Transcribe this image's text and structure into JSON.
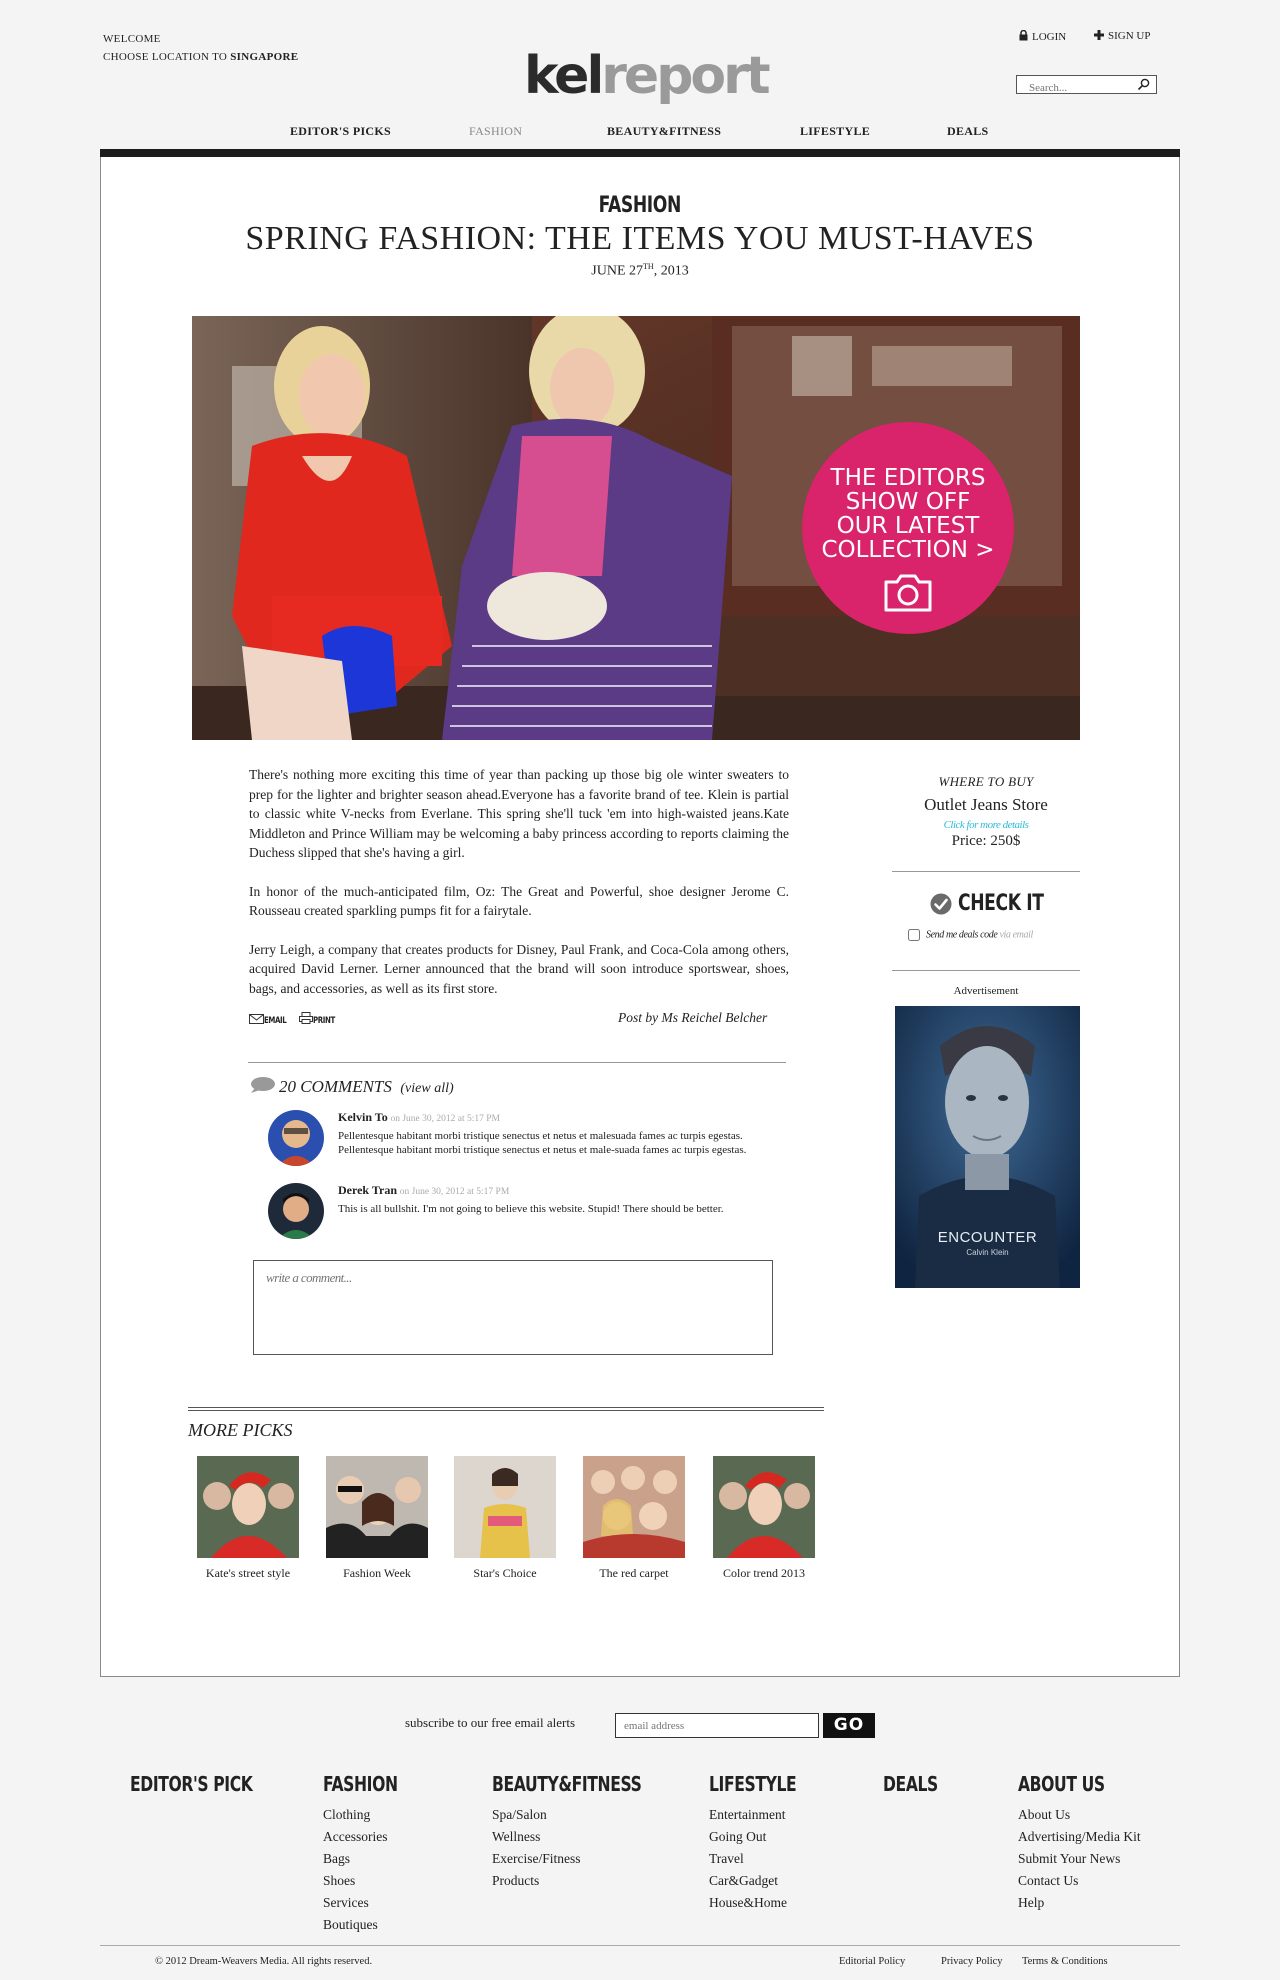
{
  "header": {
    "welcome": "WELCOME",
    "location_prefix": "CHOOSE LOCATION TO",
    "location": "SINGAPORE",
    "logo_part1": "kel",
    "logo_part2": "report",
    "login": "LOGIN",
    "signup": "SIGN UP",
    "search_placeholder": "Search..."
  },
  "nav": {
    "items": [
      "EDITOR'S PICKS",
      "FASHION",
      "BEAUTY&FITNESS",
      "LIFESTYLE",
      "DEALS"
    ],
    "active": "FASHION"
  },
  "article": {
    "section": "FASHION",
    "title": "SPRING FASHION: THE ITEMS YOU MUST-HAVES",
    "date_prefix": "JUNE 27",
    "date_sup": "TH",
    "date_suffix": ", 2013",
    "promo_lines": [
      "THE EDITORS",
      "SHOW OFF",
      "OUR LATEST",
      "COLLECTION >"
    ],
    "paragraphs": [
      "There's nothing more exciting this time of year than packing up those big ole winter sweaters to prep for the lighter and brighter season ahead.Everyone has a favorite brand of tee. Klein is partial to classic white V-necks from Everlane. This spring she'll tuck 'em into high-waisted jeans.Kate Middleton and Prince William may be welcoming a baby princess according to reports claiming the Duchess slipped that she's having a girl.",
      "In honor of the much-anticipated film, Oz: The Great and Powerful, shoe designer Jerome C. Rousseau created sparkling pumps fit for a fairytale.",
      "Jerry Leigh, a company that creates products for Disney, Paul Frank, and Coca-Cola among others, acquired David Lerner. Lerner announced that the brand will soon introduce sportswear, shoes, bags, and accessories, as well as its first store."
    ],
    "email_label": "EMAIL",
    "print_label": "PRINT",
    "byline": "Post by Ms Reichel Belcher"
  },
  "comments": {
    "count_label": "20 COMMENTS",
    "view_all": "(view all)",
    "items": [
      {
        "name": "Kelvin To",
        "time": "on June 30, 2012 at 5:17 PM",
        "text": "Pellentesque habitant morbi tristique senectus et netus et malesuada fames ac turpis egestas. Pellentesque habitant morbi tristique senectus et netus et male-suada fames ac turpis egestas."
      },
      {
        "name": "Derek Tran",
        "time": "on June 30, 2012 at 5:17 PM",
        "text": "This is all bullshit. I'm not going to believe this website. Stupid! There should be better."
      }
    ],
    "write_placeholder": "write a comment..."
  },
  "more_picks": {
    "title": "MORE PICKS",
    "items": [
      "Kate's street style",
      "Fashion Week",
      "Star's Choice",
      "The red carpet",
      "Color trend 2013"
    ]
  },
  "sidebar": {
    "where_to_buy": "WHERE TO BUY",
    "store": "Outlet Jeans Store",
    "click": "Click for more details",
    "price": "Price: 250$",
    "checkit": "CHECK IT",
    "deals_code": "Send me deals code",
    "deals_via": "via email",
    "ad_label": "Advertisement",
    "ad_brand": "ENCOUNTER",
    "ad_sub": "Calvin Klein"
  },
  "footer": {
    "subscribe": "subscribe to our free email alerts",
    "email_placeholder": "email address",
    "go": "GO",
    "columns": [
      {
        "title": "EDITOR'S PICK",
        "items": []
      },
      {
        "title": "FASHION",
        "items": [
          "Clothing",
          "Accessories",
          "Bags",
          "Shoes",
          "Services",
          "Boutiques"
        ]
      },
      {
        "title": "BEAUTY&FITNESS",
        "items": [
          "Spa/Salon",
          "Wellness",
          "Exercise/Fitness",
          "Products"
        ]
      },
      {
        "title": "LIFESTYLE",
        "items": [
          "Entertainment",
          "Going Out",
          "Travel",
          "Car&Gadget",
          "House&Home"
        ]
      },
      {
        "title": "DEALS",
        "items": []
      },
      {
        "title": "ABOUT US",
        "items": [
          "About Us",
          "Advertising/Media Kit",
          "Submit Your News",
          "Contact Us",
          "Help"
        ]
      }
    ],
    "copyright": "© 2012 Dream-Weavers Media. All rights reserved.",
    "links": [
      "Editorial Policy",
      "Privacy Policy",
      "Terms & Conditions"
    ]
  },
  "colors": {
    "accent_pink": "#d9236b",
    "link_cyan": "#2fbcd6",
    "dark_bar": "#1c1c1c"
  }
}
